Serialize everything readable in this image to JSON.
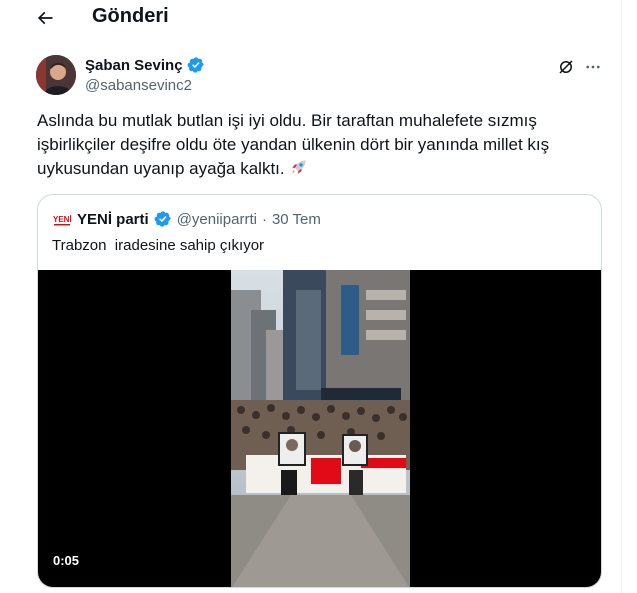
{
  "header": {
    "title": "Gönderi",
    "back_icon": "arrow-left-icon"
  },
  "tweet": {
    "author_name": "Şaban Sevinç",
    "author_handle": "@sabansevinc2",
    "text": "Aslında bu mutlak butlan işi iyi oldu. Bir taraftan muhalefete sızmış işbirlikçiler deşifre oldu öte yandan ülkenin dört bir yanında millet kış uykusundan uyanıp ayağa kalktı.",
    "emoji": "rocket-icon",
    "verified_color": "#1d9bf0"
  },
  "quote": {
    "author_name": "YENİ parti",
    "author_handle": "@yeniiparrti",
    "separator": "·",
    "date": "30 Tem",
    "text": "Trabzon  iradesine sahip çıkıyor",
    "video_time": "0:05"
  },
  "colors": {
    "text_primary": "#0f1419",
    "text_secondary": "#536471",
    "border": "#cfd9de",
    "accent": "#1d9bf0"
  }
}
